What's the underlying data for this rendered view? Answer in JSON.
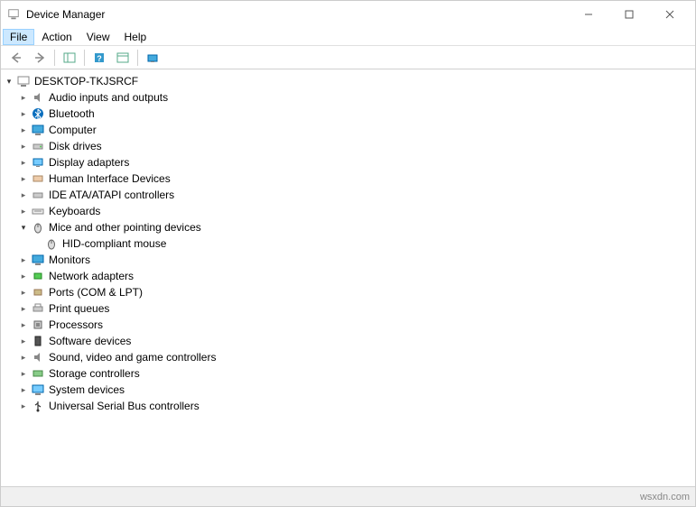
{
  "window": {
    "title": "Device Manager"
  },
  "menu": {
    "file": "File",
    "action": "Action",
    "view": "View",
    "help": "Help"
  },
  "tree": {
    "root": "DESKTOP-TKJSRCF",
    "categories": {
      "audio": "Audio inputs and outputs",
      "bluetooth": "Bluetooth",
      "computer": "Computer",
      "disk": "Disk drives",
      "display": "Display adapters",
      "hid": "Human Interface Devices",
      "ide": "IDE ATA/ATAPI controllers",
      "keyboards": "Keyboards",
      "mice": "Mice and other pointing devices",
      "monitors": "Monitors",
      "network": "Network adapters",
      "ports": "Ports (COM & LPT)",
      "printqueues": "Print queues",
      "processors": "Processors",
      "software": "Software devices",
      "sound": "Sound, video and game controllers",
      "storage": "Storage controllers",
      "system": "System devices",
      "usb": "Universal Serial Bus controllers"
    },
    "children": {
      "hidMouse": "HID-compliant mouse"
    }
  },
  "statusbar": {
    "watermark": "wsxdn.com"
  }
}
